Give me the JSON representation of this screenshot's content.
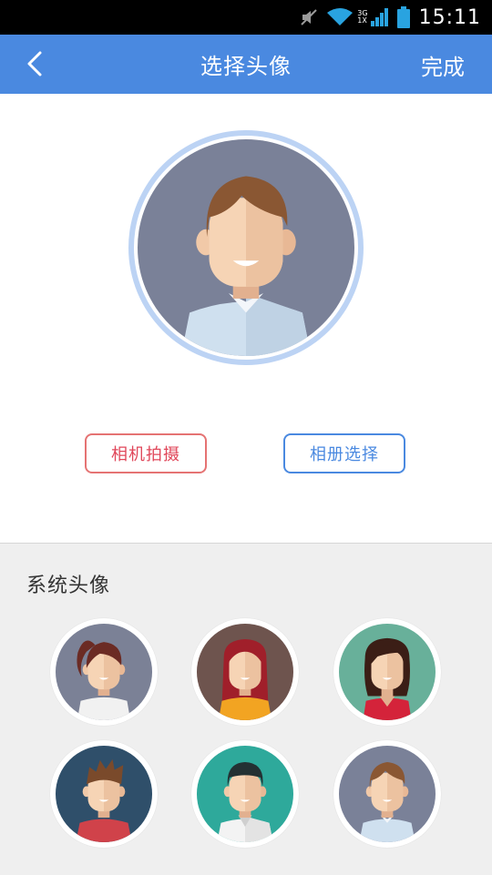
{
  "status_bar": {
    "time": "15:11",
    "network_top": "3G",
    "network_bottom": "1X",
    "icons": [
      "mute-icon",
      "wifi-icon",
      "signal-icon",
      "battery-icon"
    ]
  },
  "app_bar": {
    "back_icon": "chevron-left-icon",
    "title": "选择头像",
    "done_label": "完成",
    "color": "#4a89e0"
  },
  "actions": {
    "camera_label": "相机拍摄",
    "album_label": "相册选择",
    "camera_color": "#e57373",
    "album_color": "#4a89e0"
  },
  "system_avatars": {
    "label": "系统头像",
    "items": [
      {
        "name": "girl-ponytail",
        "bg": "#7b8196",
        "hair": "#6b2b24",
        "shirt": "#f1f1f1"
      },
      {
        "name": "girl-red-hair",
        "bg": "#6e544e",
        "hair": "#a01f2a",
        "shirt": "#f2a422"
      },
      {
        "name": "girl-dark-hair",
        "bg": "#68b09a",
        "hair": "#3b1e16",
        "shirt": "#d4233a"
      },
      {
        "name": "boy-spiky",
        "bg": "#2f4f6a",
        "hair": "#7a4a2b",
        "shirt": "#d0424a"
      },
      {
        "name": "man-dark-hair",
        "bg": "#2ea99b",
        "hair": "#233133",
        "shirt": "#f3f3f3"
      },
      {
        "name": "man-brown-hair",
        "bg": "#7a8198",
        "hair": "#8a5733",
        "shirt": "#cfe0ef"
      }
    ]
  }
}
